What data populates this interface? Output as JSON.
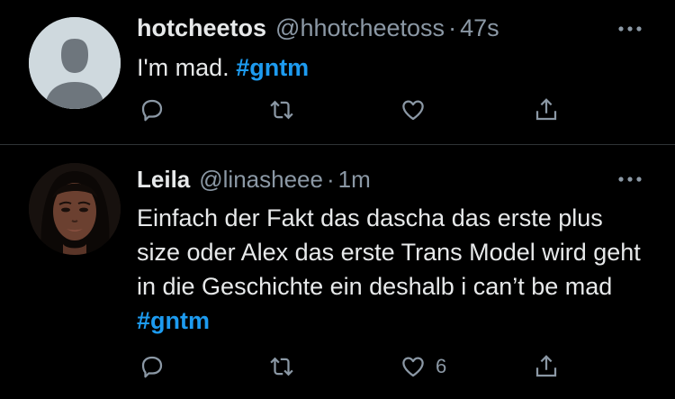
{
  "colors": {
    "background": "#000000",
    "text": "#e7e9ea",
    "muted": "#8b98a5",
    "hashtag": "#1d9bf0",
    "divider": "#2f3336"
  },
  "tweets": [
    {
      "display_name": "hotcheetos",
      "handle": "@hhotcheetoss",
      "separator": "·",
      "time": "47s",
      "text": "I'm mad. ",
      "hashtag": "#gntm",
      "avatar": "default-avatar-icon",
      "like_count": ""
    },
    {
      "display_name": "Leila",
      "handle": "@linasheee",
      "separator": "·",
      "time": "1m",
      "text": "Einfach der Fakt das dascha das erste plus size oder Alex das erste Trans Model wird geht in die Geschichte ein deshalb i can’t be mad ",
      "hashtag": "#gntm",
      "avatar": "profile-photo",
      "like_count": "6"
    }
  ],
  "icons": {
    "reply": "reply-icon",
    "retweet": "retweet-icon",
    "like": "heart-icon",
    "share": "share-icon",
    "more": "more-options-icon"
  }
}
